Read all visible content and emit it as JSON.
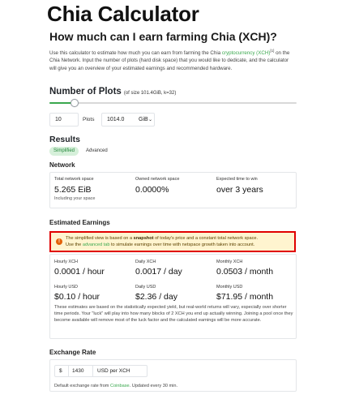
{
  "page": {
    "title": "Chia Calculator",
    "subtitle": "How much can I earn farming Chia (XCH)?",
    "intro_before": "Use this calculator to estimate how much you can earn from farming the Chia ",
    "intro_link": "cryptocurrency (XCH)",
    "intro_sup": "[1]",
    "intro_after": " on the Chia Network. Input the number of plots (hard disk space) that you would like to dedicate, and the calculator will give you an overview of your estimated earnings and recommended hardware."
  },
  "plots": {
    "heading": "Number of Plots",
    "note": "(of size 101.4GiB, k=32)",
    "slider_fraction": 0.1,
    "count": "10",
    "count_label": "Plots",
    "size_value": "1014.0",
    "size_unit": "GiB"
  },
  "results": {
    "heading": "Results",
    "tabs": [
      "Simplified",
      "Advanced"
    ],
    "active_tab": "Simplified"
  },
  "network": {
    "title": "Network",
    "stats": [
      {
        "label": "Total network space",
        "value": "5.265 EiB",
        "sub": "Including your space"
      },
      {
        "label": "Owned network space",
        "value": "0.0000%",
        "sub": ""
      },
      {
        "label": "Expected time to win",
        "value": "over 3 years",
        "sub": ""
      }
    ]
  },
  "earnings": {
    "title": "Estimated Earnings",
    "alert_line1_pre": "The simplified view is based on a ",
    "alert_line1_bold": "snapshot",
    "alert_line1_post": " of today's price and a constant total network space.",
    "alert_line2_pre": "Use the ",
    "alert_line2_link": "advanced tab",
    "alert_line2_post": " to simulate earnings over time with netspace growth taken into account.",
    "xch": [
      {
        "label": "Hourly XCH",
        "value": "0.0001 / hour"
      },
      {
        "label": "Daily XCH",
        "value": "0.0017 / day"
      },
      {
        "label": "Monthly XCH",
        "value": "0.0503 / month"
      }
    ],
    "usd": [
      {
        "label": "Hourly USD",
        "value": "$0.10 / hour"
      },
      {
        "label": "Daily USD",
        "value": "$2.36 / day"
      },
      {
        "label": "Monthly USD",
        "value": "$71.95 / month"
      }
    ],
    "disclaimer": "These estimates are based on the statistically expected yield, but real-world returns will vary, especially over shorter time periods. Your \"luck\" will play into how many blocks of 2 XCH you end up actually winning. Joining a pool once they become available will remove most of the luck factor and the calculated earnings will be more accurate."
  },
  "exchange": {
    "title": "Exchange Rate",
    "currency_symbol": "$",
    "value": "1430",
    "unit": "USD per XCH",
    "note_pre": "Default exchange rate from ",
    "note_link": "Coinbase",
    "note_post": ". Updated every 30 min."
  },
  "colors": {
    "accent": "#3aa84e",
    "alert_border": "#e00000",
    "alert_bg": "#fff4cf",
    "alert_icon": "#e36209"
  }
}
